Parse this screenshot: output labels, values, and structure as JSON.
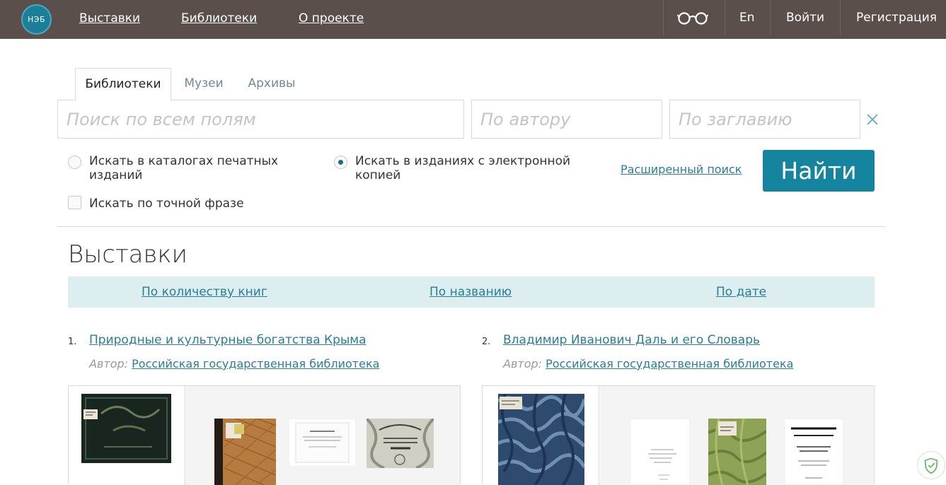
{
  "header": {
    "logo_text": "НЭБ",
    "nav": [
      "Выставки",
      "Библиотеки",
      "О проекте"
    ],
    "lang": "En",
    "login": "Войти",
    "register": "Регистрация",
    "accessibility_icon": "glasses-icon"
  },
  "search": {
    "tabs": [
      "Библиотеки",
      "Музеи",
      "Архивы"
    ],
    "active_tab": "Библиотеки",
    "all_fields_placeholder": "Поиск по всем полям",
    "author_placeholder": "По автору",
    "title_placeholder": "По заглавию",
    "option_print": "Искать в каталогах печатных изданий",
    "option_electronic": "Искать в изданиях с электронной копией",
    "selected_option": "electronic",
    "option_exact": "Искать по точной фразе",
    "advanced_link": "Расширенный поиск",
    "submit": "Найти"
  },
  "section": {
    "title": "Выставки",
    "sort": [
      "По количеству книг",
      "По названию",
      "По дате"
    ]
  },
  "exhibitions": [
    {
      "num": "1.",
      "title": "Природные и культурные богатства Крыма",
      "author_label": "Автор:",
      "author": "Российская государственная библиотека"
    },
    {
      "num": "2.",
      "title": "Владимир Иванович Даль и его Словарь",
      "author_label": "Автор:",
      "author": "Российская государственная библиотека"
    }
  ],
  "colors": {
    "header_bg": "#5b4f4b",
    "accent": "#14849f",
    "link": "#2a7d96",
    "sort_bar": "#ddeef0"
  }
}
